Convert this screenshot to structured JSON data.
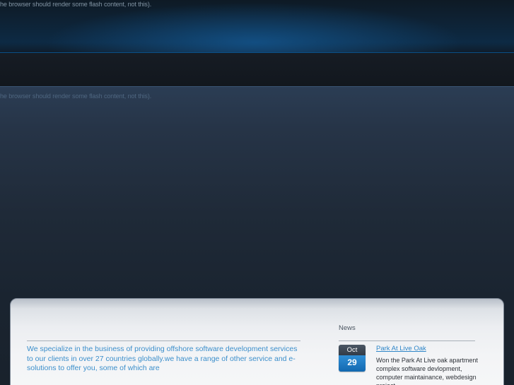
{
  "flash_notices": {
    "top": "he browser should render some flash content, not this).",
    "middle": "he browser should render some flash content, not this)."
  },
  "intro": {
    "text": "We specialize in the business of providing offshore software development services to our clients in over 27 countries globally.we have a range of other service and e-solutions to offer you, some of which are"
  },
  "news": {
    "heading": "News",
    "items": [
      {
        "month": "Oct",
        "day": "29",
        "title": "Park At Live Oak",
        "body": "Won the Park At Live oak apartment complex software devlopment, computer maintainance, webdesign project."
      }
    ]
  },
  "colors": {
    "link": "#2f86c8",
    "intro_text": "#3c8fcb",
    "date_day_bg": "#1e7cc4",
    "date_month_bg": "#3b4653"
  }
}
